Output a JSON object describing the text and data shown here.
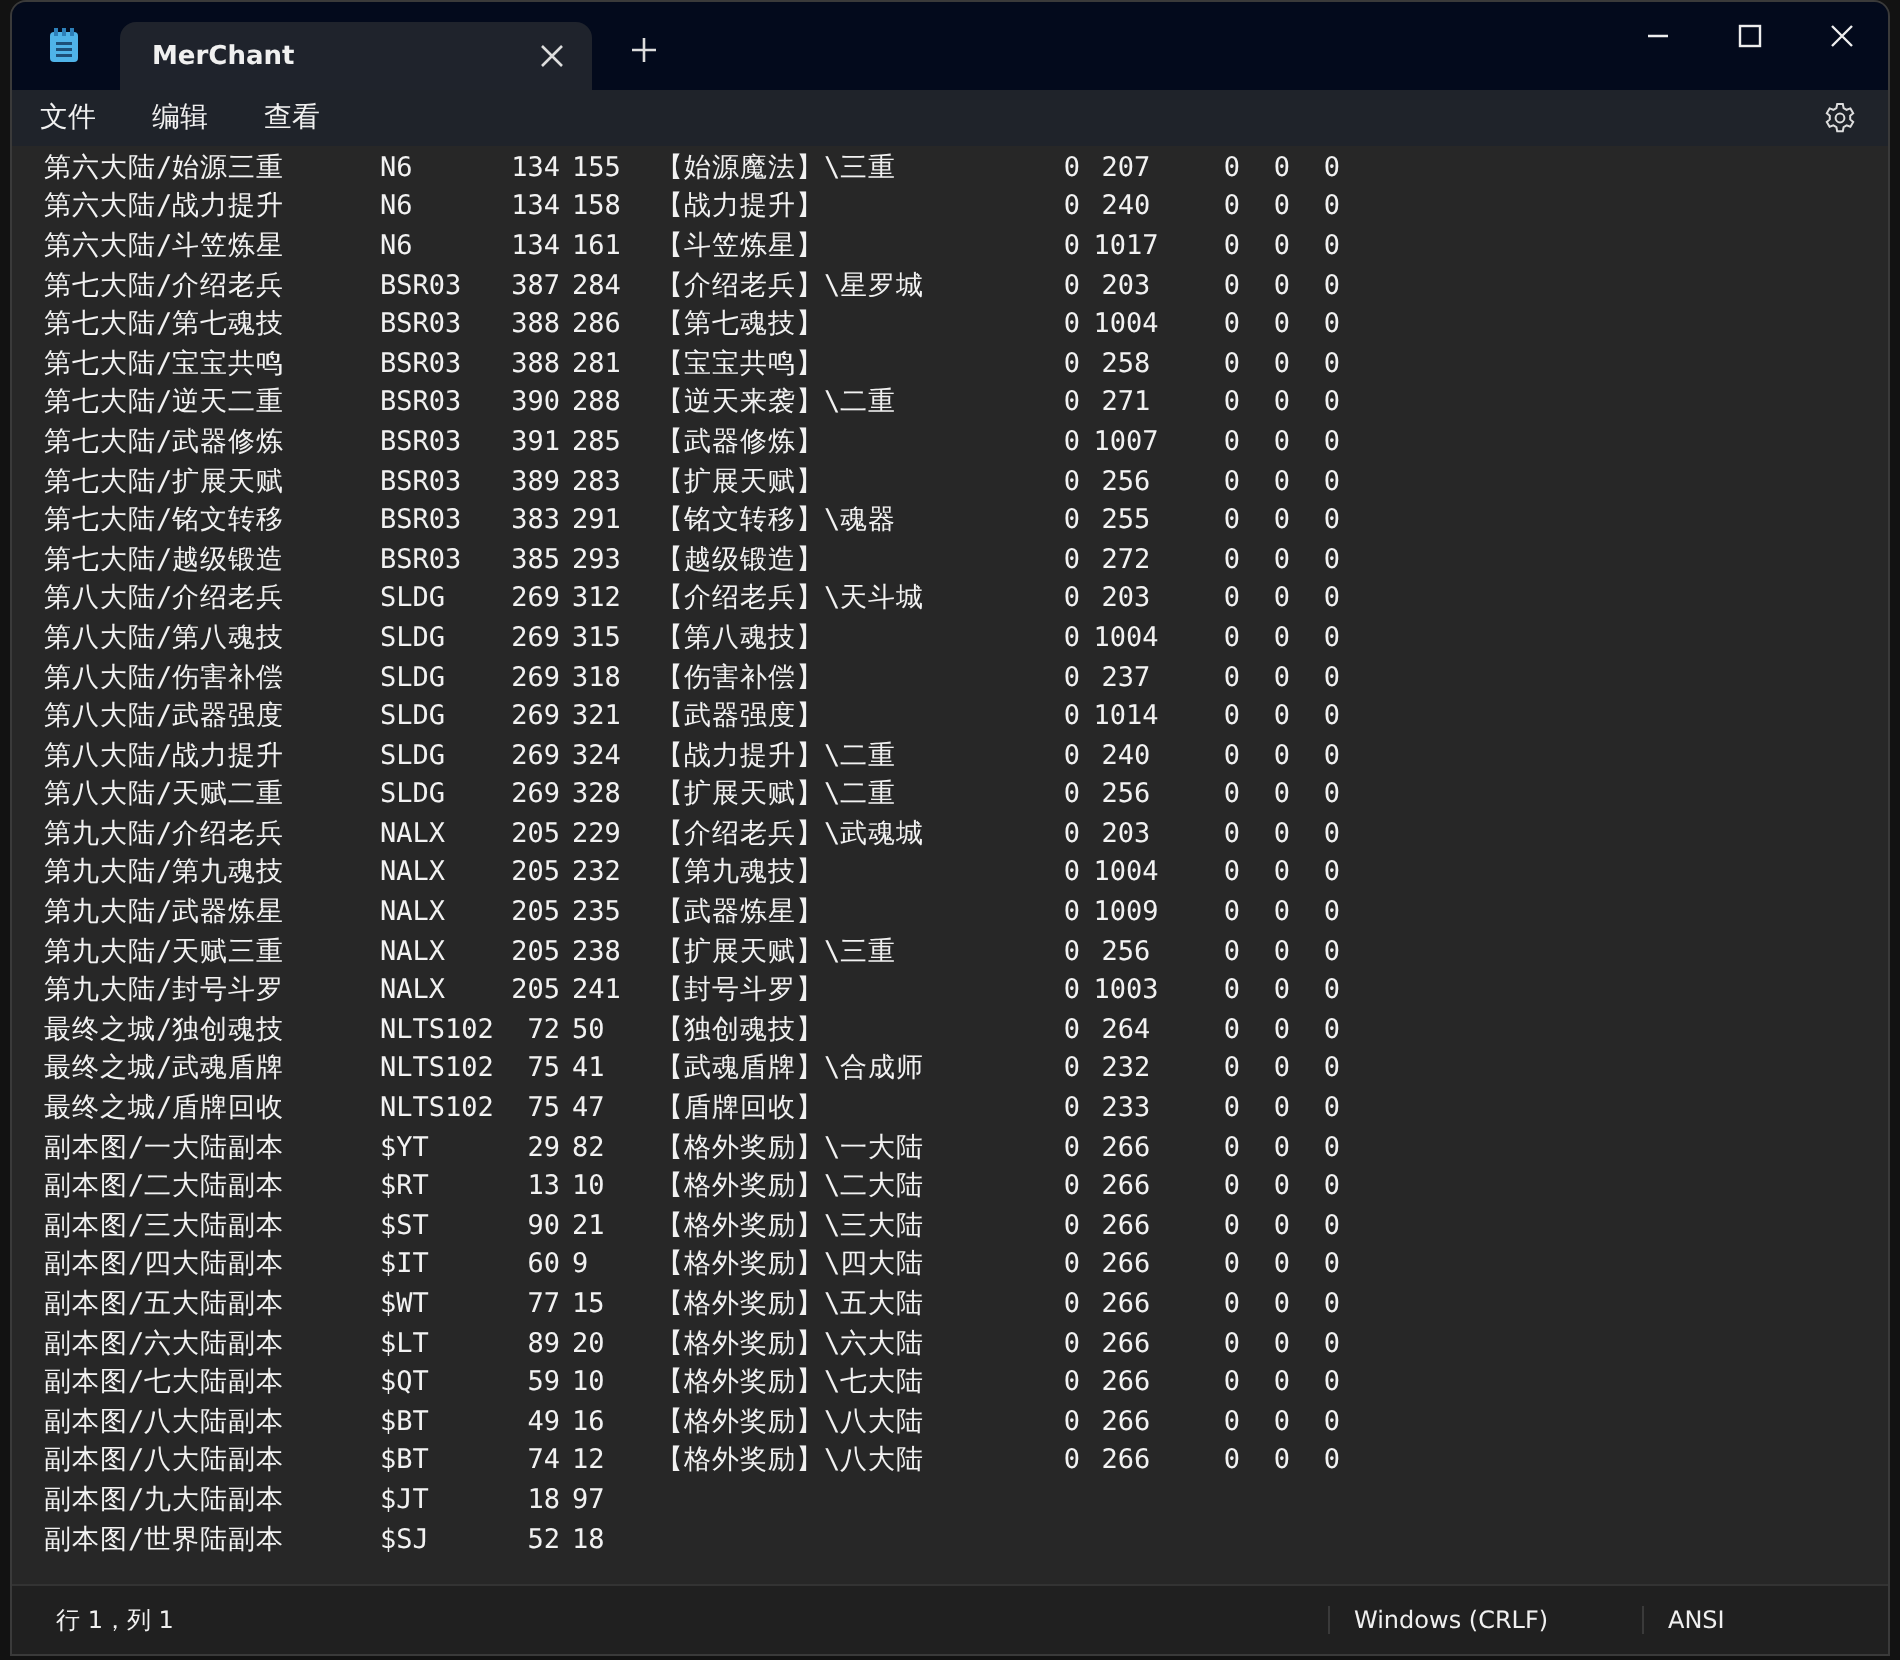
{
  "window": {
    "tab_title": "MerChant"
  },
  "menu": [
    "文件",
    "编辑",
    "查看"
  ],
  "lines": [
    {
      "cells": [
        "第六大陆/始源三重",
        "N6",
        "134",
        "155",
        "【始源魔法】\\三重",
        "0",
        "207",
        "0",
        "0",
        "0"
      ]
    },
    {
      "cells": [
        "第六大陆/战力提升",
        "N6",
        "134",
        "158",
        "【战力提升】",
        "0",
        "240",
        "0",
        "0",
        "0"
      ]
    },
    {
      "cells": [
        "第六大陆/斗笠炼星",
        "N6",
        "134",
        "161",
        "【斗笠炼星】",
        "0",
        "1017",
        "0",
        "0",
        "0"
      ]
    },
    {
      "cells": [
        "第七大陆/介绍老兵",
        "BSR03",
        "387",
        "284",
        "【介绍老兵】\\星罗城",
        "0",
        "203",
        "0",
        "0",
        "0"
      ]
    },
    {
      "cells": [
        "第七大陆/第七魂技",
        "BSR03",
        "388",
        "286",
        "【第七魂技】",
        "0",
        "1004",
        "0",
        "0",
        "0"
      ]
    },
    {
      "cells": [
        "第七大陆/宝宝共鸣",
        "BSR03",
        "388",
        "281",
        "【宝宝共鸣】",
        "0",
        "258",
        "0",
        "0",
        "0"
      ]
    },
    {
      "cells": [
        "第七大陆/逆天二重",
        "BSR03",
        "390",
        "288",
        "【逆天来袭】\\二重",
        "0",
        "271",
        "0",
        "0",
        "0"
      ]
    },
    {
      "cells": [
        "第七大陆/武器修炼",
        "BSR03",
        "391",
        "285",
        "【武器修炼】",
        "0",
        "1007",
        "0",
        "0",
        "0"
      ]
    },
    {
      "cells": [
        "第七大陆/扩展天赋",
        "BSR03",
        "389",
        "283",
        "【扩展天赋】",
        "0",
        "256",
        "0",
        "0",
        "0"
      ]
    },
    {
      "cells": [
        "第七大陆/铭文转移",
        "BSR03",
        "383",
        "291",
        "【铭文转移】\\魂器",
        "0",
        "255",
        "0",
        "0",
        "0"
      ]
    },
    {
      "cells": [
        "第七大陆/越级锻造",
        "BSR03",
        "385",
        "293",
        "【越级锻造】",
        "0",
        "272",
        "0",
        "0",
        "0"
      ]
    },
    {
      "cells": [
        "第八大陆/介绍老兵",
        "SLDG",
        "269",
        "312",
        "【介绍老兵】\\天斗城",
        "0",
        "203",
        "0",
        "0",
        "0"
      ]
    },
    {
      "cells": [
        "第八大陆/第八魂技",
        "SLDG",
        "269",
        "315",
        "【第八魂技】",
        "0",
        "1004",
        "0",
        "0",
        "0"
      ]
    },
    {
      "cells": [
        "第八大陆/伤害补偿",
        "SLDG",
        "269",
        "318",
        "【伤害补偿】",
        "0",
        "237",
        "0",
        "0",
        "0"
      ]
    },
    {
      "cells": [
        "第八大陆/武器强度",
        "SLDG",
        "269",
        "321",
        "【武器强度】",
        "0",
        "1014",
        "0",
        "0",
        "0"
      ]
    },
    {
      "cells": [
        "第八大陆/战力提升",
        "SLDG",
        "269",
        "324",
        "【战力提升】\\二重",
        "0",
        "240",
        "0",
        "0",
        "0"
      ]
    },
    {
      "cells": [
        "第八大陆/天赋二重",
        "SLDG",
        "269",
        "328",
        "【扩展天赋】\\二重",
        "0",
        "256",
        "0",
        "0",
        "0"
      ]
    },
    {
      "cells": [
        "第九大陆/介绍老兵",
        "NALX",
        "205",
        "229",
        "【介绍老兵】\\武魂城",
        "0",
        "203",
        "0",
        "0",
        "0"
      ]
    },
    {
      "cells": [
        "第九大陆/第九魂技",
        "NALX",
        "205",
        "232",
        "【第九魂技】",
        "0",
        "1004",
        "0",
        "0",
        "0"
      ]
    },
    {
      "cells": [
        "第九大陆/武器炼星",
        "NALX",
        "205",
        "235",
        "【武器炼星】",
        "0",
        "1009",
        "0",
        "0",
        "0"
      ]
    },
    {
      "cells": [
        "第九大陆/天赋三重",
        "NALX",
        "205",
        "238",
        "【扩展天赋】\\三重",
        "0",
        "256",
        "0",
        "0",
        "0"
      ]
    },
    {
      "cells": [
        "第九大陆/封号斗罗",
        "NALX",
        "205",
        "241",
        "【封号斗罗】",
        "0",
        "1003",
        "0",
        "0",
        "0"
      ]
    },
    {
      "cells": [
        "最终之城/独创魂技",
        "NLTS102",
        "72",
        "50",
        "【独创魂技】",
        "0",
        "264",
        "0",
        "0",
        "0"
      ]
    },
    {
      "cells": [
        "最终之城/武魂盾牌",
        "NLTS102",
        "75",
        "41",
        "【武魂盾牌】\\合成师",
        "0",
        "232",
        "0",
        "0",
        "0"
      ]
    },
    {
      "cells": [
        "最终之城/盾牌回收",
        "NLTS102",
        "75",
        "47",
        "【盾牌回收】",
        "0",
        "233",
        "0",
        "0",
        "0"
      ]
    },
    {
      "cells": [
        "副本图/一大陆副本",
        "$YT",
        "29",
        "82",
        "【格外奖励】\\一大陆",
        "0",
        "266",
        "0",
        "0",
        "0"
      ]
    },
    {
      "cells": [
        "副本图/二大陆副本",
        "$RT",
        "13",
        "10",
        "【格外奖励】\\二大陆",
        "0",
        "266",
        "0",
        "0",
        "0"
      ]
    },
    {
      "cells": [
        "副本图/三大陆副本",
        "$ST",
        "90",
        "21",
        "【格外奖励】\\三大陆",
        "0",
        "266",
        "0",
        "0",
        "0"
      ]
    },
    {
      "cells": [
        "副本图/四大陆副本",
        "$IT",
        "60",
        "9",
        "【格外奖励】\\四大陆",
        "0",
        "266",
        "0",
        "0",
        "0"
      ]
    },
    {
      "cells": [
        "副本图/五大陆副本",
        "$WT",
        "77",
        "15",
        "【格外奖励】\\五大陆",
        "0",
        "266",
        "0",
        "0",
        "0"
      ]
    },
    {
      "cells": [
        "副本图/六大陆副本",
        "$LT",
        "89",
        "20",
        "【格外奖励】\\六大陆",
        "0",
        "266",
        "0",
        "0",
        "0"
      ]
    },
    {
      "cells": [
        "副本图/七大陆副本",
        "$QT",
        "59",
        "10",
        "【格外奖励】\\七大陆",
        "0",
        "266",
        "0",
        "0",
        "0"
      ]
    },
    {
      "cells": [
        "副本图/八大陆副本",
        "$BT",
        "49",
        "16",
        "【格外奖励】\\八大陆",
        "0",
        "266",
        "0",
        "0",
        "0"
      ]
    },
    {
      "cells": [
        "副本图/八大陆副本",
        "$BT",
        "74",
        "12",
        "【格外奖励】\\八大陆",
        "0",
        "266",
        "0",
        "0",
        "0"
      ]
    },
    {
      "cells": [
        "副本图/九大陆副本",
        "$JT",
        "18",
        "97"
      ]
    },
    {
      "cells": [
        "副本图/世界陆副本",
        "$SJ",
        "52",
        "18"
      ]
    }
  ],
  "status_bar": {
    "position": "行 1，列 1",
    "line_ending": "Windows (CRLF)",
    "encoding": "ANSI"
  }
}
